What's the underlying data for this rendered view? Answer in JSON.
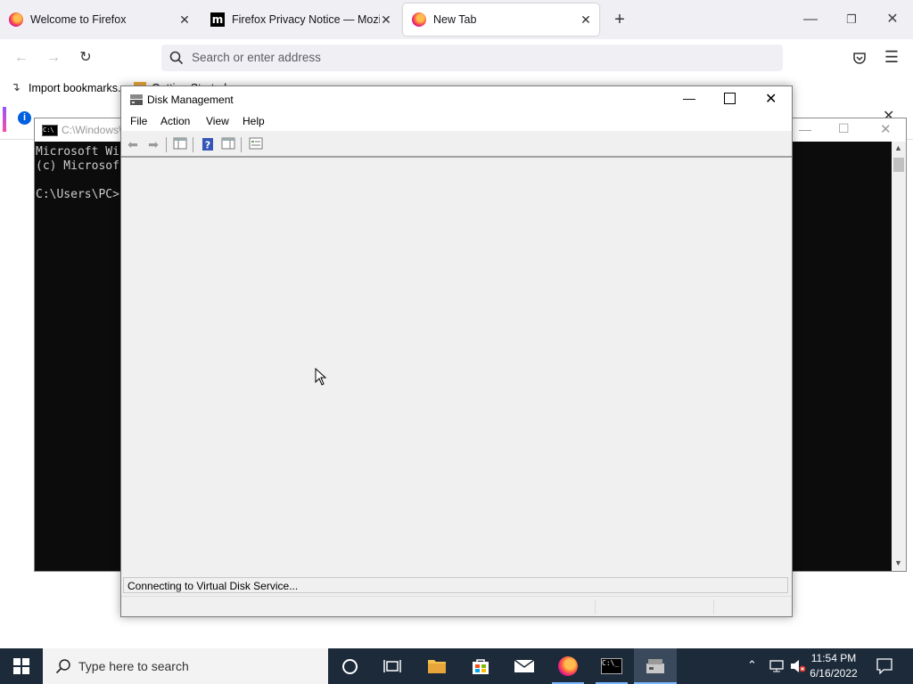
{
  "firefox": {
    "tabs": [
      {
        "title": "Welcome to Firefox",
        "active": false
      },
      {
        "title": "Firefox Privacy Notice — Mozill",
        "active": false
      },
      {
        "title": "New Tab",
        "active": true
      }
    ],
    "new_tab_symbol": "+",
    "url_placeholder": "Search or enter address",
    "bookmarks": [
      {
        "label": "Import bookmarks..."
      },
      {
        "label": "Getting Started"
      }
    ]
  },
  "cmd": {
    "title": "C:\\Windows\\",
    "lines": [
      "Microsoft Wi",
      "(c) Microsof",
      "",
      "C:\\Users\\PC>"
    ]
  },
  "disk_management": {
    "title": "Disk Management",
    "menu": [
      "File",
      "Action",
      "View",
      "Help"
    ],
    "status_text": "Connecting to Virtual Disk Service..."
  },
  "taskbar": {
    "search_placeholder": "Type here to search",
    "time": "11:54 PM",
    "date": "6/16/2022",
    "accent": "#0078d7"
  }
}
